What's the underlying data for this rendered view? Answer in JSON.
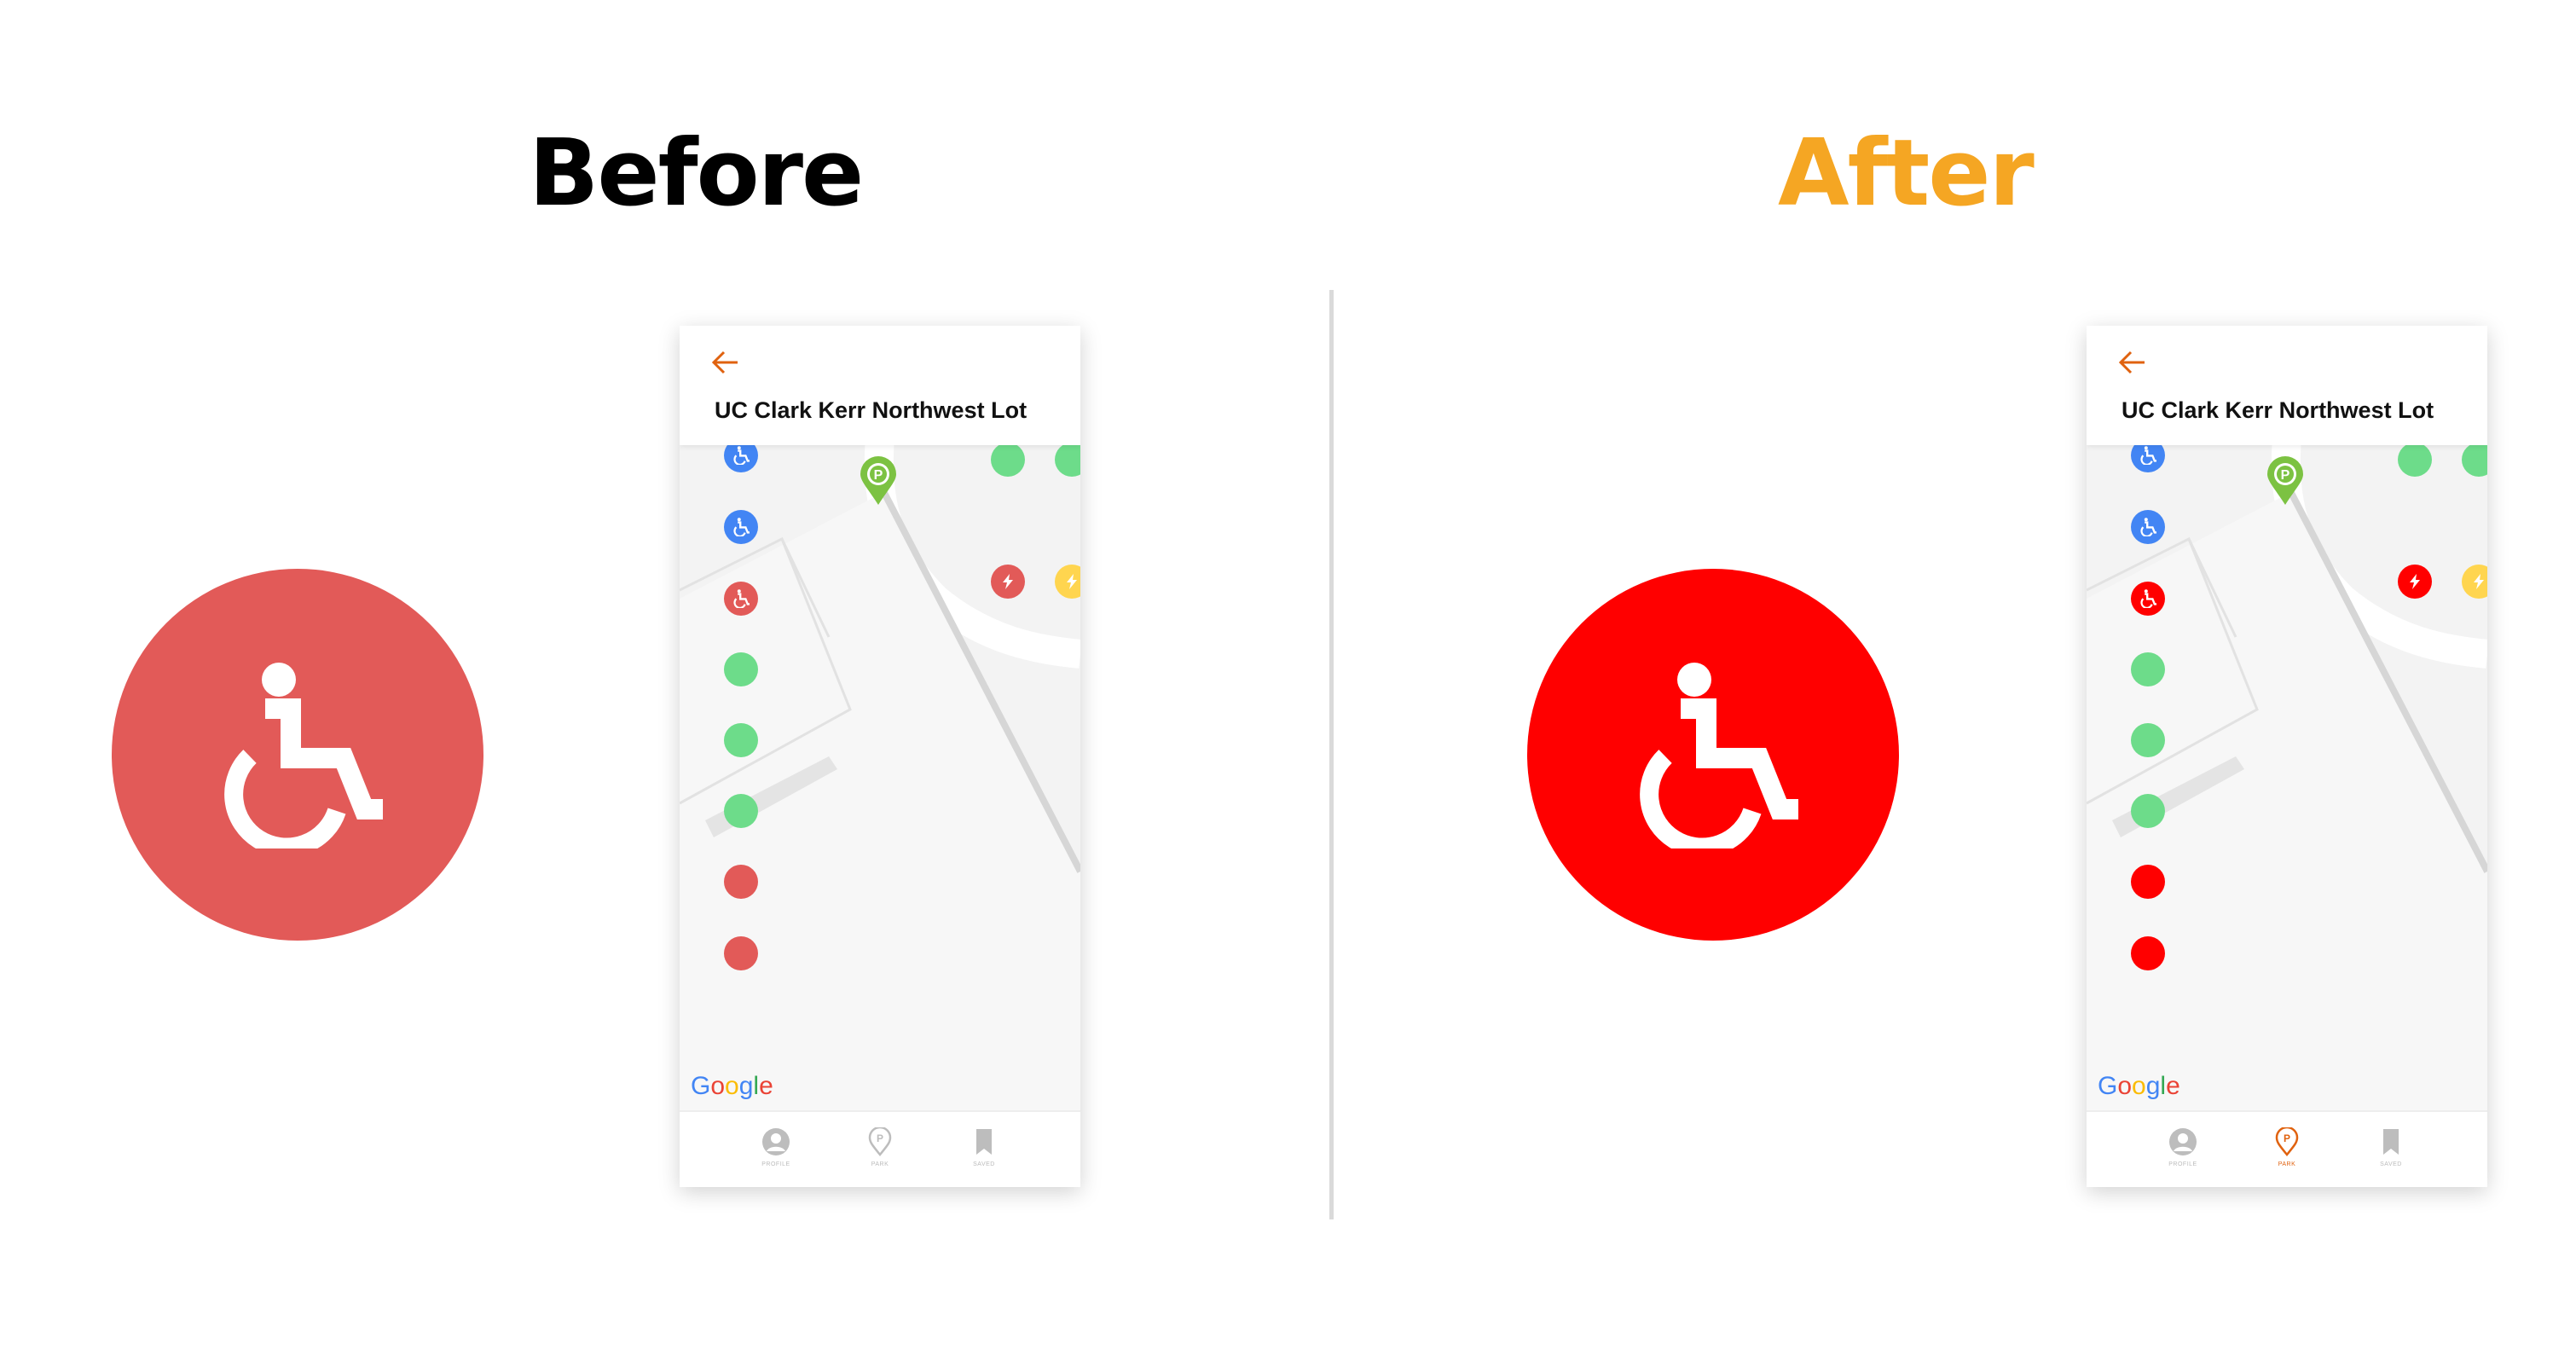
{
  "headings": {
    "before": "Before",
    "after": "After"
  },
  "colors": {
    "before_red": "#e25a58",
    "after_red": "#ff0000",
    "after_heading": "#f5a623",
    "blue_spot": "#4285f4",
    "green_spot": "#6ddc8a",
    "yellow_spot": "#ffd54f",
    "parking_pin": "#7cc242",
    "accent_orange": "#e0620f"
  },
  "icons": {
    "big": "wheelchair-accessible-icon",
    "back": "arrow-left-icon",
    "ev": "lightning-icon",
    "pin": "parking-pin-icon",
    "nav": [
      "profile-icon",
      "parking-icon",
      "bookmark-icon"
    ]
  },
  "screens": {
    "before": {
      "title": "UC Clark Kerr Northwest Lot",
      "google": [
        "G",
        "o",
        "o",
        "g",
        "l",
        "e"
      ],
      "nav": {
        "profile": "PROFILE",
        "park": "PARK",
        "saved": "SAVED",
        "active": "none"
      }
    },
    "after": {
      "title": "UC Clark Kerr Northwest Lot",
      "google": [
        "G",
        "o",
        "o",
        "g",
        "l",
        "e"
      ],
      "nav": {
        "profile": "PROFILE",
        "park": "PARK",
        "saved": "SAVED",
        "active": "park"
      }
    }
  }
}
